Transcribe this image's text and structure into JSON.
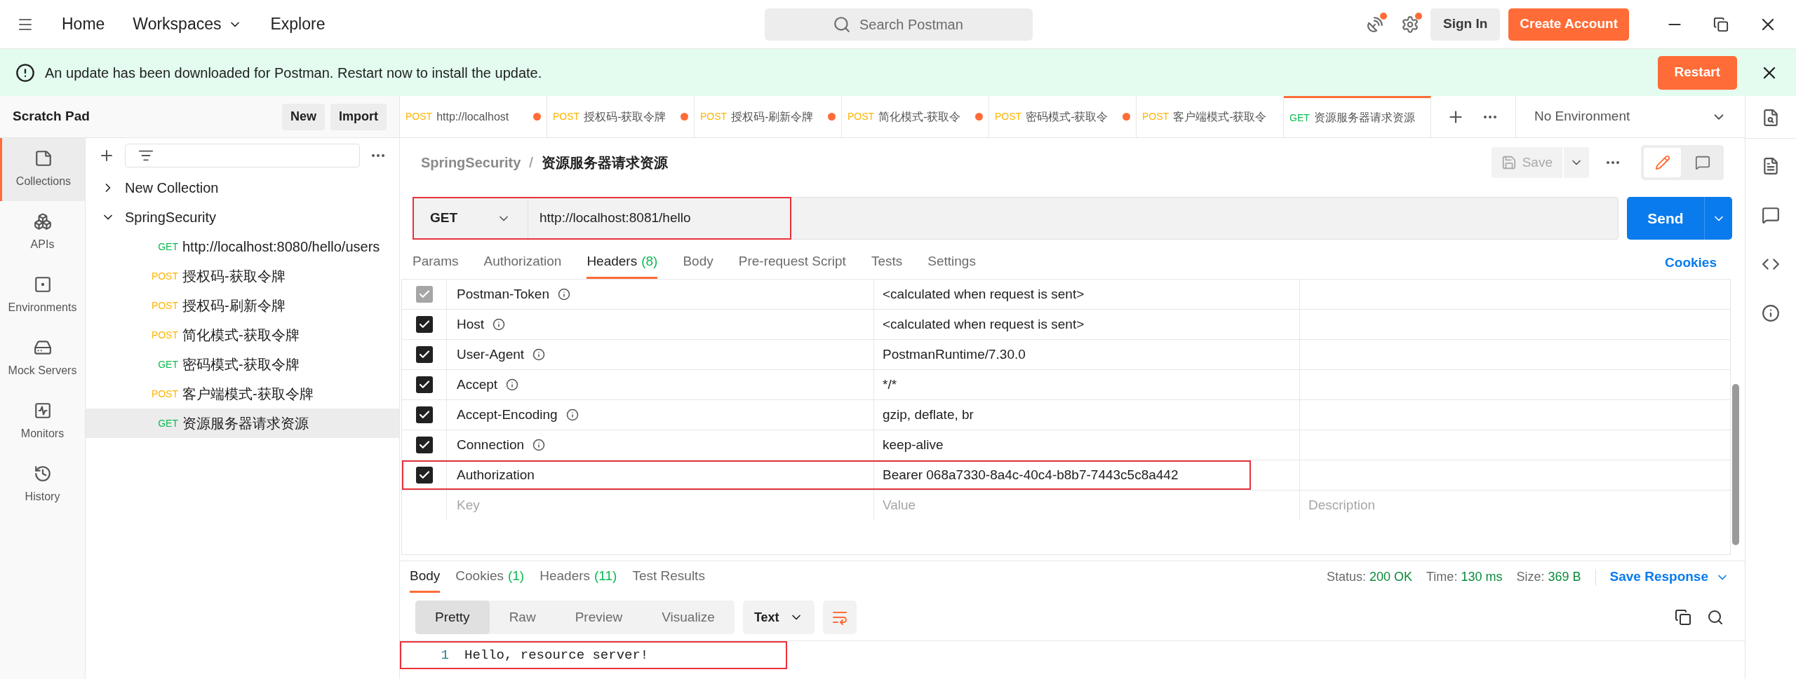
{
  "top_bar": {
    "nav": [
      {
        "label": "Home",
        "has_menu": false
      },
      {
        "label": "Workspaces",
        "has_menu": true
      },
      {
        "label": "Explore",
        "has_menu": false
      }
    ],
    "search": {
      "placeholder": "Search Postman"
    },
    "notifications": {
      "unread": true
    },
    "settings": {
      "unread": true
    },
    "sign_in": "Sign In",
    "create_account": "Create Account"
  },
  "banner": {
    "message": "An update has been downloaded for Postman. Restart now to install the update.",
    "button": "Restart"
  },
  "sidebar": {
    "title": "Scratch Pad",
    "buttons": [
      "New",
      "Import"
    ],
    "rail": [
      {
        "label": "Collections",
        "selected": true
      },
      {
        "label": "APIs",
        "selected": false
      },
      {
        "label": "Environments",
        "selected": false
      },
      {
        "label": "Mock Servers",
        "selected": false
      },
      {
        "label": "Monitors",
        "selected": false
      },
      {
        "label": "History",
        "selected": false
      }
    ],
    "tree": [
      {
        "label": "New Collection",
        "expanded": false
      },
      {
        "label": "SpringSecurity",
        "expanded": true,
        "children": [
          {
            "method": "GET",
            "color": "#0cbb52",
            "label": "http://localhost:8080/hello/users",
            "selected": false
          },
          {
            "method": "POST",
            "color": "#ffb400",
            "label": "授权码-获取令牌",
            "selected": false
          },
          {
            "method": "POST",
            "color": "#ffb400",
            "label": "授权码-刷新令牌",
            "selected": false
          },
          {
            "method": "POST",
            "color": "#ffb400",
            "label": "简化模式-获取令牌",
            "selected": false
          },
          {
            "method": "GET",
            "color": "#0cbb52",
            "label": "密码模式-获取令牌",
            "selected": false
          },
          {
            "method": "POST",
            "color": "#ffb400",
            "label": "客户端模式-获取令牌",
            "selected": false
          },
          {
            "method": "GET",
            "color": "#0cbb52",
            "label": "资源服务器请求资源",
            "selected": true
          }
        ]
      }
    ]
  },
  "tabs": [
    {
      "method": "POST",
      "color": "#ffb400",
      "label": "http://localhost",
      "unsaved": true,
      "selected": false
    },
    {
      "method": "POST",
      "color": "#ffb400",
      "label": "授权码-获取令牌",
      "unsaved": true,
      "selected": false
    },
    {
      "method": "POST",
      "color": "#ffb400",
      "label": "授权码-刷新令牌",
      "unsaved": true,
      "selected": false
    },
    {
      "method": "POST",
      "color": "#ffb400",
      "label": "简化模式-获取令",
      "unsaved": true,
      "selected": false
    },
    {
      "method": "POST",
      "color": "#ffb400",
      "label": "密码模式-获取令",
      "unsaved": true,
      "selected": false
    },
    {
      "method": "POST",
      "color": "#ffb400",
      "label": "客户端模式-获取令",
      "unsaved": false,
      "selected": false
    },
    {
      "method": "GET",
      "color": "#0cbb52",
      "label": "资源服务器请求资源",
      "unsaved": false,
      "selected": true
    }
  ],
  "environment": "No Environment",
  "breadcrumb": {
    "collection": "SpringSecurity",
    "separator": "/",
    "request": "资源服务器请求资源"
  },
  "view_toggle": [
    {
      "kind": "edit",
      "selected": true
    },
    {
      "kind": "comments",
      "selected": false
    }
  ],
  "save": "Save",
  "request": {
    "method": "GET",
    "url": "http://localhost:8081/hello",
    "send": "Send",
    "highlighted": true
  },
  "request_tabs": [
    {
      "label": "Params",
      "selected": false
    },
    {
      "label": "Authorization",
      "selected": false
    },
    {
      "label": "Headers",
      "count": "(8)",
      "selected": true
    },
    {
      "label": "Body",
      "selected": false
    },
    {
      "label": "Pre-request Script",
      "selected": false
    },
    {
      "label": "Tests",
      "selected": false
    },
    {
      "label": "Settings",
      "selected": false
    }
  ],
  "cookies": "Cookies",
  "headers": {
    "rows": [
      {
        "key": "Postman-Token",
        "value": "<calculated when request is sent>",
        "checked": true,
        "disabled": true,
        "info": true,
        "highlighted": false
      },
      {
        "key": "Host",
        "value": "<calculated when request is sent>",
        "checked": true,
        "disabled": false,
        "info": true,
        "highlighted": false
      },
      {
        "key": "User-Agent",
        "value": "PostmanRuntime/7.30.0",
        "checked": true,
        "disabled": false,
        "info": true,
        "highlighted": false
      },
      {
        "key": "Accept",
        "value": "*/*",
        "checked": true,
        "disabled": false,
        "info": true,
        "highlighted": false
      },
      {
        "key": "Accept-Encoding",
        "value": "gzip, deflate, br",
        "checked": true,
        "disabled": false,
        "info": true,
        "highlighted": false
      },
      {
        "key": "Connection",
        "value": "keep-alive",
        "checked": true,
        "disabled": false,
        "info": true,
        "highlighted": false
      },
      {
        "key": "Authorization",
        "value": "Bearer 068a7330-8a4c-40c4-b8b7-7443c5c8a442",
        "checked": true,
        "disabled": false,
        "info": false,
        "highlighted": true
      }
    ],
    "new_row": {
      "key": "Key",
      "value": "Value",
      "description": "Description"
    }
  },
  "response": {
    "tabs": [
      {
        "label": "Body",
        "selected": true
      },
      {
        "label": "Cookies",
        "count": "(1)",
        "selected": false
      },
      {
        "label": "Headers",
        "count": "(11)",
        "selected": false
      },
      {
        "label": "Test Results",
        "selected": false
      }
    ],
    "stats": [
      {
        "label": "Status:",
        "value": "200 OK"
      },
      {
        "label": "Time:",
        "value": "130 ms"
      },
      {
        "label": "Size:",
        "value": "369 B"
      }
    ],
    "save_response": "Save Response",
    "view_modes": [
      {
        "label": "Pretty",
        "selected": true
      },
      {
        "label": "Raw",
        "selected": false
      },
      {
        "label": "Preview",
        "selected": false
      },
      {
        "label": "Visualize",
        "selected": false
      }
    ],
    "format": "Text",
    "lines": [
      {
        "number": "1",
        "text": "Hello, resource server!",
        "highlighted": true
      }
    ]
  }
}
